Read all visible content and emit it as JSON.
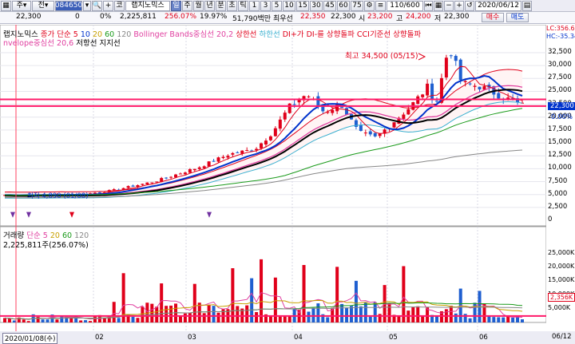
{
  "toolbar": {
    "stock_icon": "magnifier-icon",
    "ju": "주",
    "jeon": "전",
    "code_value": "084650",
    "ko_label": "코",
    "stock_name": "랩지노믹스",
    "period_tabs": [
      "일",
      "주",
      "월",
      "년",
      "분",
      "초",
      "틱"
    ],
    "selected_tab": "일",
    "minute_values": [
      "1",
      "3",
      "5",
      "10",
      "15",
      "30",
      "45",
      "60",
      "75"
    ],
    "count_display": "110/600",
    "date_value": "2020/06/12"
  },
  "quote": {
    "price": "22,300",
    "change": "0",
    "change_pct": "0%",
    "volume": "2,225,811",
    "volume_ratio": "256.07%",
    "turnover": "19.97%",
    "amount": "51,790백만",
    "best_label": "최우선",
    "best_price": "22,350",
    "ask_price": "22,300",
    "open_label": "시",
    "open": "23,200",
    "high_label": "고",
    "high": "24,200",
    "close_label": "저",
    "low": "22,300",
    "buy_label": "매수",
    "sell_label": "매도"
  },
  "price_panel": {
    "legend1": [
      {
        "text": "랩지노믹스",
        "color": "#000000"
      },
      {
        "text": "종가 단순 5",
        "color": "#e0001a"
      },
      {
        "text": "10",
        "color": "#0033cc"
      },
      {
        "text": "20",
        "color": "#c8a000"
      },
      {
        "text": "60",
        "color": "#1a9a1a"
      },
      {
        "text": "120",
        "color": "#888888"
      },
      {
        "text": "Bollinger Bands중심선 20,2",
        "color": "#e040a0"
      },
      {
        "text": "상한선",
        "color": "#e0001a"
      },
      {
        "text": "하한선",
        "color": "#3bb0d0"
      },
      {
        "text": "DI+가 DI-를 상향돌파",
        "color": "#e0001a"
      },
      {
        "text": "CCI기준선 상향돌파",
        "color": "#e0001a"
      }
    ],
    "legend2": [
      {
        "text": "nvelope중심선 20,6",
        "color": "#e040a0"
      },
      {
        "text": "저항선",
        "color": "#000000"
      },
      {
        "text": "지지선",
        "color": "#000000"
      }
    ],
    "annotation_high": "최고 34,500 (05/15)",
    "annotation_low": "최저 4,890 (01/08)",
    "current_price_tag": "22,300",
    "lc_label": "LC:356.60",
    "hc_label": "HC:-35.34",
    "pct_label": "0.00%",
    "y_ticks": [
      "32,500",
      "30,000",
      "27,500",
      "25,000",
      "22,500",
      "20,000",
      "17,500",
      "15,000",
      "12,500",
      "10,000",
      "7,500",
      "5,000",
      "2,500",
      "0"
    ]
  },
  "volume_panel": {
    "legend": [
      {
        "text": "거래량",
        "color": "#000000"
      },
      {
        "text": "단순 5",
        "color": "#e040a0"
      },
      {
        "text": "20",
        "color": "#c8a000"
      },
      {
        "text": "60",
        "color": "#1a9a1a"
      },
      {
        "text": "120",
        "color": "#888888"
      }
    ],
    "volume_readout": "2,225,811주(256.07%)",
    "current_volume_tag": "2,356K",
    "y_ticks": [
      "25,000K",
      "20,000K",
      "15,000K",
      "10,000K",
      "5,000K"
    ]
  },
  "x_axis": {
    "start_date": "2020/01/08(수)",
    "months": [
      "02",
      "03",
      "04",
      "05",
      "06"
    ],
    "end_label": "06/12"
  },
  "colors": {
    "up": "#e0001a",
    "down": "#1f5fd0",
    "ma5": "#e0001a",
    "ma10": "#0033cc",
    "ma20": "#c8a000",
    "ma60": "#1a9a1a",
    "ma120": "#888888",
    "bb_mid": "#e040a0",
    "bb_upper": "#e0001a",
    "bb_lower": "#3bb0d0",
    "envelope": "#000000",
    "price_line": "#ff1a6a"
  }
}
